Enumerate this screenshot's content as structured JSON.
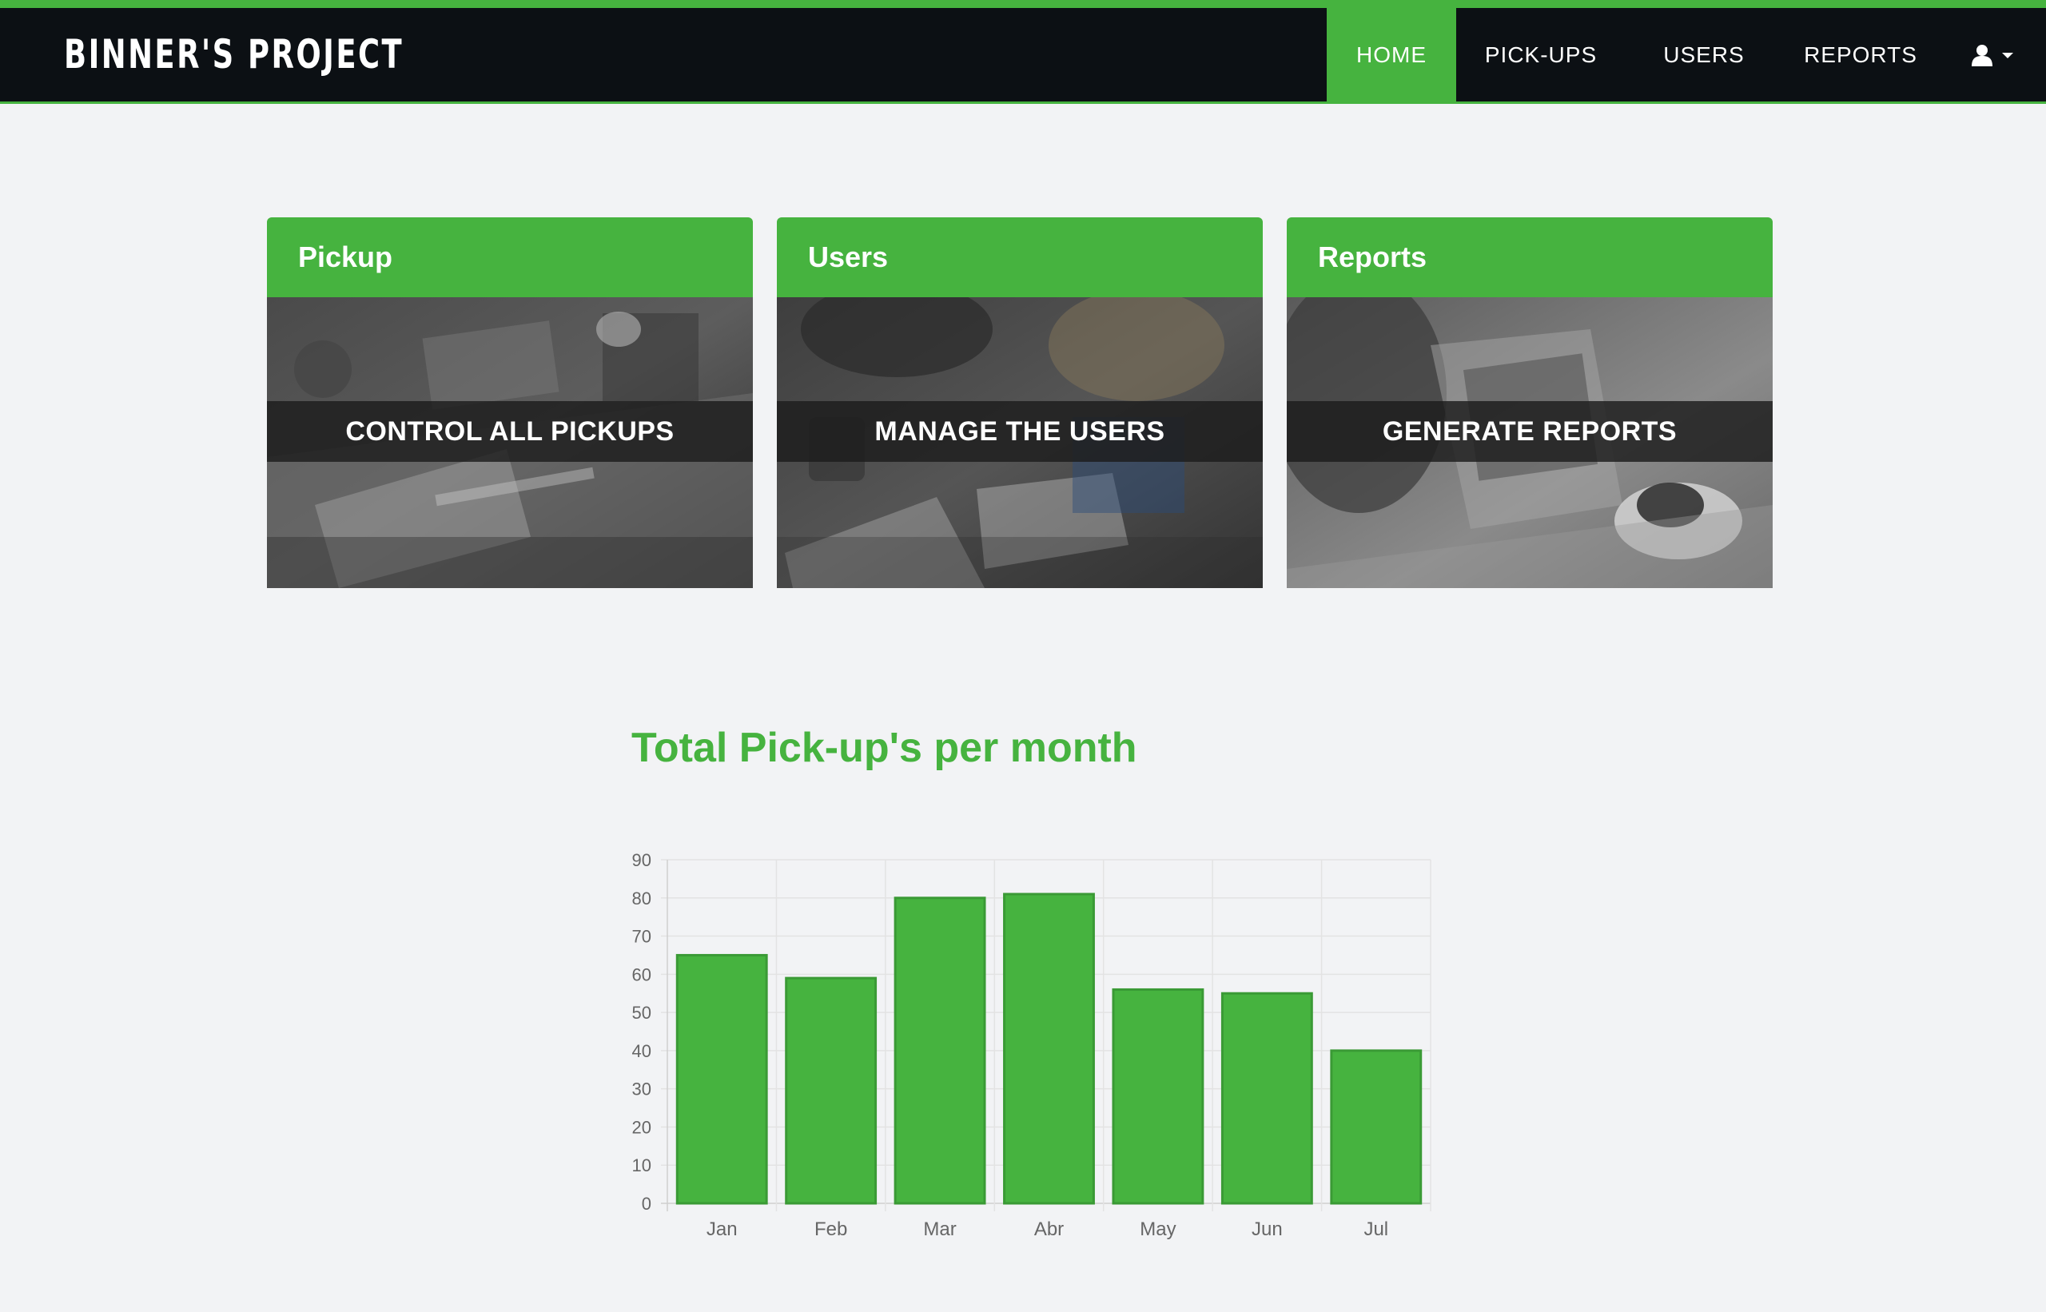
{
  "navbar": {
    "brand": "BINNER'S PROJECT",
    "items": [
      {
        "label": "HOME",
        "active": true
      },
      {
        "label": "PICK-UPS",
        "active": false
      },
      {
        "label": "USERS",
        "active": false
      },
      {
        "label": "REPORTS",
        "active": false
      }
    ],
    "user_icon": "user-icon",
    "caret_icon": "caret-down-icon"
  },
  "cards": [
    {
      "title": "Pickup",
      "caption": "CONTROL ALL PICKUPS"
    },
    {
      "title": "Users",
      "caption": "MANAGE THE USERS"
    },
    {
      "title": "Reports",
      "caption": "GENERATE REPORTS"
    }
  ],
  "colors": {
    "accent": "#46b33f",
    "navbar_bg": "#0c1014",
    "page_bg": "#f2f3f5",
    "bar_border": "#3a9a35"
  },
  "chart_data": {
    "type": "bar",
    "title": "Total Pick-up's per month",
    "categories": [
      "Jan",
      "Feb",
      "Mar",
      "Abr",
      "May",
      "Jun",
      "Jul"
    ],
    "values": [
      65,
      59,
      80,
      81,
      56,
      55,
      40
    ],
    "ylim": [
      0,
      90
    ],
    "yticks": [
      0,
      10,
      20,
      30,
      40,
      50,
      60,
      70,
      80,
      90
    ],
    "xlabel": "",
    "ylabel": "",
    "grid": true,
    "legend": "none"
  }
}
